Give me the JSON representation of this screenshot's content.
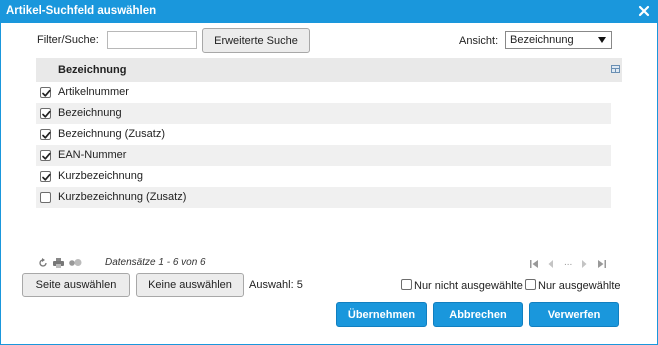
{
  "dialog": {
    "title": "Artikel-Suchfeld auswählen"
  },
  "toolbar": {
    "filter_label": "Filter/Suche:",
    "filter_value": "",
    "advanced_search_label": "Erweiterte Suche",
    "view_label": "Ansicht:",
    "view_selected": "Bezeichnung"
  },
  "table": {
    "column_header": "Bezeichnung",
    "rows": [
      {
        "label": "Artikelnummer",
        "checked": true
      },
      {
        "label": "Bezeichnung",
        "checked": true
      },
      {
        "label": "Bezeichnung (Zusatz)",
        "checked": true
      },
      {
        "label": "EAN-Nummer",
        "checked": true
      },
      {
        "label": "Kurzbezeichnung",
        "checked": true
      },
      {
        "label": "Kurzbezeichnung (Zusatz)",
        "checked": false
      }
    ]
  },
  "pager": {
    "records_text": "Datensätze 1 - 6 von 6",
    "ellipsis": "..."
  },
  "selection": {
    "select_page_label": "Seite auswählen",
    "select_none_label": "Keine auswählen",
    "count_text": "Auswahl: 5",
    "only_unselected_label": "Nur nicht ausgewählte",
    "only_selected_label": "Nur ausgewählte"
  },
  "actions": {
    "apply_label": "Übernehmen",
    "cancel_label": "Abbrechen",
    "discard_label": "Verwerfen"
  },
  "colors": {
    "accent": "#1a97dc",
    "header_bg": "#e9e9e9",
    "row_alt_bg": "#f0f0f0"
  },
  "icons": {
    "close": "close-icon",
    "column_chooser": "column-chooser-icon",
    "refresh": "refresh-icon",
    "print": "print-icon",
    "options": "dots-icon",
    "first": "first-page-icon",
    "prev": "prev-page-icon",
    "next": "next-page-icon",
    "last": "last-page-icon"
  }
}
